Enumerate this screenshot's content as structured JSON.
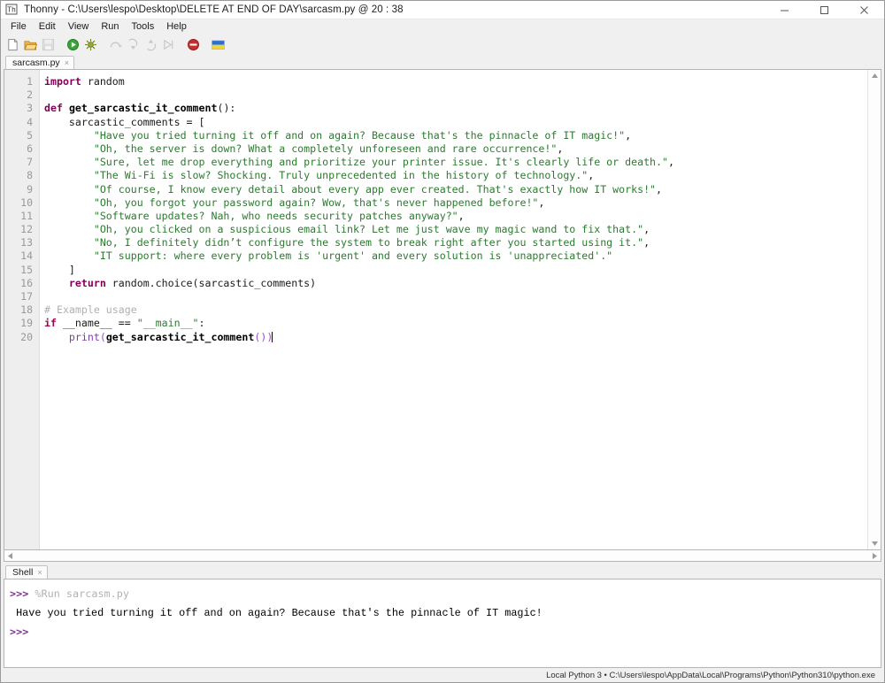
{
  "window": {
    "title": "Thonny  -  C:\\Users\\lespo\\Desktop\\DELETE AT END OF DAY\\sarcasm.py  @  20 : 38",
    "app_icon": "thonny-icon",
    "minimize_label": "—",
    "maximize_label": "☐",
    "close_label": "✕"
  },
  "menubar": {
    "items": [
      {
        "label": "File"
      },
      {
        "label": "Edit"
      },
      {
        "label": "View"
      },
      {
        "label": "Run"
      },
      {
        "label": "Tools"
      },
      {
        "label": "Help"
      }
    ]
  },
  "toolbar": {
    "buttons": [
      {
        "name": "new-file-icon",
        "tooltip": "New",
        "enabled": true
      },
      {
        "name": "open-folder-icon",
        "tooltip": "Load",
        "enabled": true
      },
      {
        "name": "save-icon",
        "tooltip": "Save",
        "enabled": false
      },
      {
        "name": "run-icon",
        "tooltip": "Run current script",
        "enabled": true
      },
      {
        "name": "debug-icon",
        "tooltip": "Debug current script",
        "enabled": true
      },
      {
        "name": "step-over-icon",
        "tooltip": "Step over",
        "enabled": false
      },
      {
        "name": "step-into-icon",
        "tooltip": "Step into",
        "enabled": false
      },
      {
        "name": "step-out-icon",
        "tooltip": "Step out",
        "enabled": false
      },
      {
        "name": "resume-icon",
        "tooltip": "Resume",
        "enabled": false
      },
      {
        "name": "stop-icon",
        "tooltip": "Stop/Restart backend",
        "enabled": true
      },
      {
        "name": "ukraine-flag-icon",
        "tooltip": "Support Ukraine",
        "enabled": true
      }
    ]
  },
  "editor": {
    "tab": {
      "label": "sarcasm.py",
      "close_glyph": "×"
    },
    "line_numbers": [
      "1",
      "2",
      "3",
      "4",
      "5",
      "6",
      "7",
      "8",
      "9",
      "10",
      "11",
      "12",
      "13",
      "14",
      "15",
      "16",
      "17",
      "18",
      "19",
      "20"
    ],
    "lines": [
      {
        "n": 1,
        "tokens": [
          {
            "t": "kw",
            "v": "import"
          },
          {
            "t": "plain",
            "v": " random"
          }
        ]
      },
      {
        "n": 2,
        "tokens": []
      },
      {
        "n": 3,
        "tokens": [
          {
            "t": "kw",
            "v": "def"
          },
          {
            "t": "plain",
            "v": " "
          },
          {
            "t": "fn",
            "v": "get_sarcastic_it_comment"
          },
          {
            "t": "plain",
            "v": "():"
          }
        ]
      },
      {
        "n": 4,
        "tokens": [
          {
            "t": "plain",
            "v": "    sarcastic_comments = ["
          }
        ]
      },
      {
        "n": 5,
        "tokens": [
          {
            "t": "plain",
            "v": "        "
          },
          {
            "t": "str",
            "v": "\"Have you tried turning it off and on again? Because that's the pinnacle of IT magic!\""
          },
          {
            "t": "plain",
            "v": ","
          }
        ]
      },
      {
        "n": 6,
        "tokens": [
          {
            "t": "plain",
            "v": "        "
          },
          {
            "t": "str",
            "v": "\"Oh, the server is down? What a completely unforeseen and rare occurrence!\""
          },
          {
            "t": "plain",
            "v": ","
          }
        ]
      },
      {
        "n": 7,
        "tokens": [
          {
            "t": "plain",
            "v": "        "
          },
          {
            "t": "str",
            "v": "\"Sure, let me drop everything and prioritize your printer issue. It's clearly life or death.\""
          },
          {
            "t": "plain",
            "v": ","
          }
        ]
      },
      {
        "n": 8,
        "tokens": [
          {
            "t": "plain",
            "v": "        "
          },
          {
            "t": "str",
            "v": "\"The Wi-Fi is slow? Shocking. Truly unprecedented in the history of technology.\""
          },
          {
            "t": "plain",
            "v": ","
          }
        ]
      },
      {
        "n": 9,
        "tokens": [
          {
            "t": "plain",
            "v": "        "
          },
          {
            "t": "str",
            "v": "\"Of course, I know every detail about every app ever created. That's exactly how IT works!\""
          },
          {
            "t": "plain",
            "v": ","
          }
        ]
      },
      {
        "n": 10,
        "tokens": [
          {
            "t": "plain",
            "v": "        "
          },
          {
            "t": "str",
            "v": "\"Oh, you forgot your password again? Wow, that's never happened before!\""
          },
          {
            "t": "plain",
            "v": ","
          }
        ]
      },
      {
        "n": 11,
        "tokens": [
          {
            "t": "plain",
            "v": "        "
          },
          {
            "t": "str",
            "v": "\"Software updates? Nah, who needs security patches anyway?\""
          },
          {
            "t": "plain",
            "v": ","
          }
        ]
      },
      {
        "n": 12,
        "tokens": [
          {
            "t": "plain",
            "v": "        "
          },
          {
            "t": "str",
            "v": "\"Oh, you clicked on a suspicious email link? Let me just wave my magic wand to fix that.\""
          },
          {
            "t": "plain",
            "v": ","
          }
        ]
      },
      {
        "n": 13,
        "tokens": [
          {
            "t": "plain",
            "v": "        "
          },
          {
            "t": "str",
            "v": "\"No, I definitely didn’t configure the system to break right after you started using it.\""
          },
          {
            "t": "plain",
            "v": ","
          }
        ]
      },
      {
        "n": 14,
        "tokens": [
          {
            "t": "plain",
            "v": "        "
          },
          {
            "t": "str",
            "v": "\"IT support: where every problem is 'urgent' and every solution is 'unappreciated'.\""
          }
        ]
      },
      {
        "n": 15,
        "tokens": [
          {
            "t": "plain",
            "v": "    ]"
          }
        ]
      },
      {
        "n": 16,
        "tokens": [
          {
            "t": "plain",
            "v": "    "
          },
          {
            "t": "kw",
            "v": "return"
          },
          {
            "t": "plain",
            "v": " random.choice(sarcastic_comments)"
          }
        ]
      },
      {
        "n": 17,
        "tokens": []
      },
      {
        "n": 18,
        "tokens": [
          {
            "t": "com",
            "v": "# Example usage"
          }
        ]
      },
      {
        "n": 19,
        "tokens": [
          {
            "t": "kw2",
            "v": "if"
          },
          {
            "t": "plain",
            "v": " __name__ == "
          },
          {
            "t": "str",
            "v": "\"__main__\""
          },
          {
            "t": "plain",
            "v": ":"
          }
        ]
      },
      {
        "n": 20,
        "tokens": [
          {
            "t": "plain",
            "v": "    "
          },
          {
            "t": "builtin",
            "v": "print"
          },
          {
            "t": "paren",
            "v": "("
          },
          {
            "t": "fn",
            "v": "get_sarcastic_it_comment"
          },
          {
            "t": "paren",
            "v": "()"
          },
          {
            "t": "paren",
            "v": ")"
          },
          {
            "t": "caret",
            "v": ""
          }
        ]
      }
    ]
  },
  "shell": {
    "tab": {
      "label": "Shell",
      "close_glyph": "×"
    },
    "lines": [
      {
        "prompt": ">>>",
        "magic": " %Run sarcasm.py",
        "output": ""
      },
      {
        "prompt": "",
        "magic": "",
        "output": " Have you tried turning it off and on again? Because that's the pinnacle of IT magic!"
      },
      {
        "prompt": ">>>",
        "magic": "",
        "output": ""
      }
    ]
  },
  "statusbar": {
    "text": "Local Python 3  •  C:\\Users\\lespo\\AppData\\Local\\Programs\\Python\\Python310\\python.exe"
  },
  "colors": {
    "keyword": "#7f0055",
    "string": "#2d7a30",
    "comment": "#b0b0b0",
    "builtin": "#7a3fa8",
    "prompt": "#7b2d8e",
    "gutter_bg": "#eeeeee",
    "editor_bg": "#ffffff",
    "chrome_bg": "#f0f0f0"
  }
}
